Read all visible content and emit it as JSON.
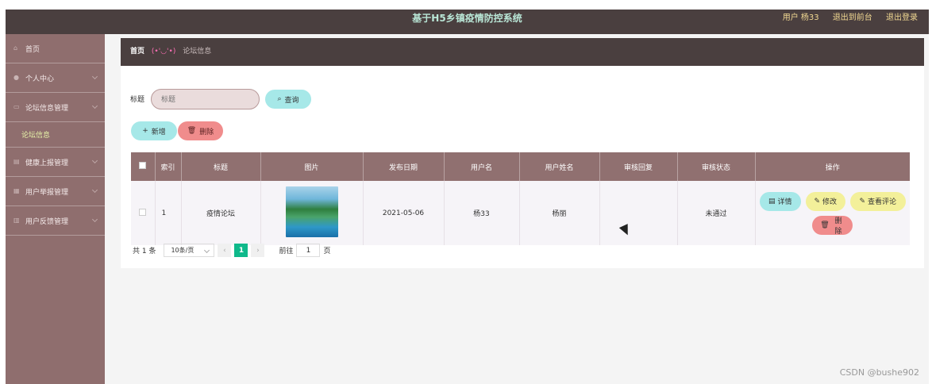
{
  "header": {
    "title": "基于H5乡镇疫情防控系统",
    "user": "用户 杨33",
    "back_link": "退出到前台",
    "logout_link": "退出登录"
  },
  "sidebar": {
    "items": [
      {
        "label": "首页",
        "icon": "home-icon"
      },
      {
        "label": "个人中心",
        "icon": "user-icon"
      },
      {
        "label": "论坛信息管理",
        "icon": "chat-icon"
      },
      {
        "label": "健康上报管理",
        "icon": "report-icon"
      },
      {
        "label": "用户举报管理",
        "icon": "flag-icon"
      },
      {
        "label": "用户反馈管理",
        "icon": "feedback-icon"
      }
    ],
    "submenu": "论坛信息"
  },
  "breadcrumb": {
    "home": "首页",
    "face": "(•'◡'•)",
    "current": "论坛信息"
  },
  "search": {
    "label": "标题",
    "placeholder": "标题",
    "query_button": "查询"
  },
  "actions": {
    "add": "新增",
    "delete": "删除"
  },
  "table": {
    "headers": [
      "索引",
      "标题",
      "图片",
      "发布日期",
      "用户名",
      "用户姓名",
      "审核回复",
      "审核状态",
      "操作"
    ],
    "rows": [
      {
        "index": "1",
        "title": "疫情论坛",
        "date": "2021-05-06",
        "username": "杨33",
        "name": "杨丽",
        "reply": "",
        "status": "未通过",
        "ops": {
          "detail": "详情",
          "edit": "修改",
          "comments": "查看评论",
          "delete": "删除"
        }
      }
    ]
  },
  "pagination": {
    "total": "共 1 条",
    "page_size": "10条/页",
    "current_page": "1",
    "goto_label": "前往",
    "goto_value": "1",
    "page_unit": "页"
  },
  "watermark": "CSDN @bushe902",
  "colors": {
    "topbar": "#4a3f3f",
    "sidebar": "#8f6e6e",
    "table_header": "#907070",
    "accent_cyan": "#a6e8e8",
    "accent_yellow": "#f3f09a",
    "accent_red": "#f08c8c",
    "pager_active": "#0fb98b"
  }
}
